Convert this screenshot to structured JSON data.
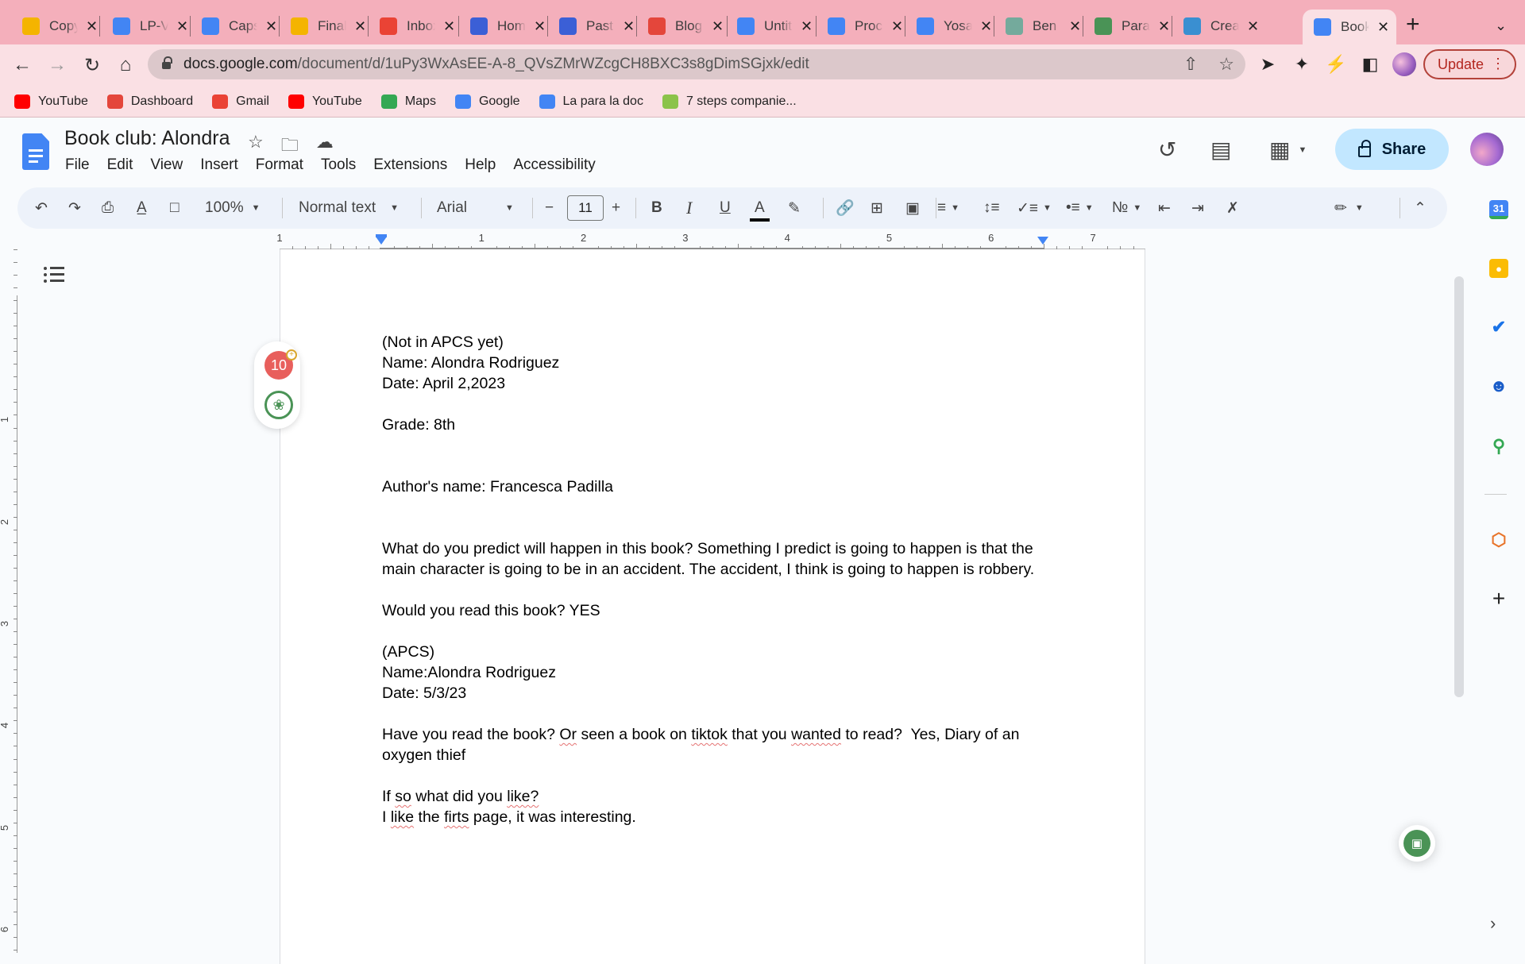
{
  "browser": {
    "tabs": [
      {
        "label": "Copy",
        "icon": "slides-icon",
        "color": "#f4b400",
        "active": false
      },
      {
        "label": "LP-V",
        "icon": "docs-icon",
        "color": "#4285f4",
        "active": false
      },
      {
        "label": "Caps",
        "icon": "docs-icon",
        "color": "#4285f4",
        "active": false
      },
      {
        "label": "Final",
        "icon": "slides-icon",
        "color": "#f4b400",
        "active": false
      },
      {
        "label": "Inbox",
        "icon": "gmail-icon",
        "color": "#ea4335",
        "active": false
      },
      {
        "label": "Home",
        "icon": "canva-icon",
        "color": "#3b5fd6",
        "active": false
      },
      {
        "label": "Past",
        "icon": "canva-icon",
        "color": "#3b5fd6",
        "active": false
      },
      {
        "label": "Blog",
        "icon": "canvas-lms-icon",
        "color": "#e4463b",
        "active": false
      },
      {
        "label": "Untit",
        "icon": "docs-icon",
        "color": "#4285f4",
        "active": false
      },
      {
        "label": "Proc",
        "icon": "docs-icon",
        "color": "#4285f4",
        "active": false
      },
      {
        "label": "Yosa",
        "icon": "docs-icon",
        "color": "#4285f4",
        "active": false
      },
      {
        "label": "Ben",
        "icon": "chatgpt-icon",
        "color": "#74aa9c",
        "active": false
      },
      {
        "label": "Para",
        "icon": "quillbot-icon",
        "color": "#4a9356",
        "active": false
      },
      {
        "label": "Crea",
        "icon": "feather-pen-icon",
        "color": "#3a8fd1",
        "active": false
      },
      {
        "label": "Book",
        "icon": "docs-icon",
        "color": "#4285f4",
        "active": true
      }
    ],
    "url_host": "docs.google.com",
    "url_path": "/document/d/1uPy3WxAsEE-A-8_QVsZMrWZcgCH8BXC3s8gDimSGjxk/edit",
    "update_label": "Update",
    "bookmarks": [
      {
        "label": "YouTube",
        "icon": "youtube-icon",
        "color": "#ff0000"
      },
      {
        "label": "Dashboard",
        "icon": "canvas-lms-icon",
        "color": "#e4463b"
      },
      {
        "label": "Gmail",
        "icon": "gmail-icon",
        "color": "#ea4335"
      },
      {
        "label": "YouTube",
        "icon": "youtube-icon",
        "color": "#ff0000"
      },
      {
        "label": "Maps",
        "icon": "maps-icon",
        "color": "#34a853"
      },
      {
        "label": "Google",
        "icon": "google-icon",
        "color": "#4285f4"
      },
      {
        "label": "La para la doc",
        "icon": "docs-icon",
        "color": "#4285f4"
      },
      {
        "label": "7 steps companie...",
        "icon": "g-green-icon",
        "color": "#8bc34a"
      }
    ]
  },
  "docs": {
    "title": "Book club: Alondra",
    "menu": [
      "File",
      "Edit",
      "View",
      "Insert",
      "Format",
      "Tools",
      "Extensions",
      "Help",
      "Accessibility"
    ],
    "share_label": "Share",
    "toolbar": {
      "zoom": "100%",
      "style": "Normal text",
      "font": "Arial",
      "font_size": "11",
      "bold": "B",
      "italic": "I",
      "underline": "U",
      "text_color": "A"
    },
    "ruler": {
      "h_numbers": [
        "1",
        "1",
        "2",
        "3",
        "4",
        "5",
        "6",
        "7"
      ],
      "v_numbers": [
        "1",
        "2",
        "3",
        "4",
        "5",
        "6"
      ]
    },
    "grammar_widget": {
      "count": "10"
    },
    "body": [
      {
        "text": "(Not in APCS yet)"
      },
      {
        "text": "Name: Alondra Rodriguez"
      },
      {
        "text": "Date: April 2,2023"
      },
      {
        "text": ""
      },
      {
        "text": "Grade: 8th"
      },
      {
        "text": ""
      },
      {
        "text": ""
      },
      {
        "text": "Author's name: Francesca Padilla"
      },
      {
        "text": ""
      },
      {
        "text": ""
      },
      {
        "text": "What do you predict will happen in this book? Something I predict is going to happen is that the main character is going to be in an accident. The accident, I think is going to happen is robbery."
      },
      {
        "text": ""
      },
      {
        "text": "Would you read this book? YES"
      },
      {
        "text": ""
      },
      {
        "text": "(APCS)"
      },
      {
        "text": "Name:Alondra Rodriguez"
      },
      {
        "text": "Date: 5/3/23"
      },
      {
        "text": ""
      },
      {
        "text": "Have you read the book? Or seen a book on tiktok that you wanted to read?  Yes, Diary of an oxygen thief"
      },
      {
        "text": ""
      },
      {
        "text": "If so what did you like?"
      },
      {
        "text": "I like the firts page, it was interesting."
      }
    ]
  }
}
